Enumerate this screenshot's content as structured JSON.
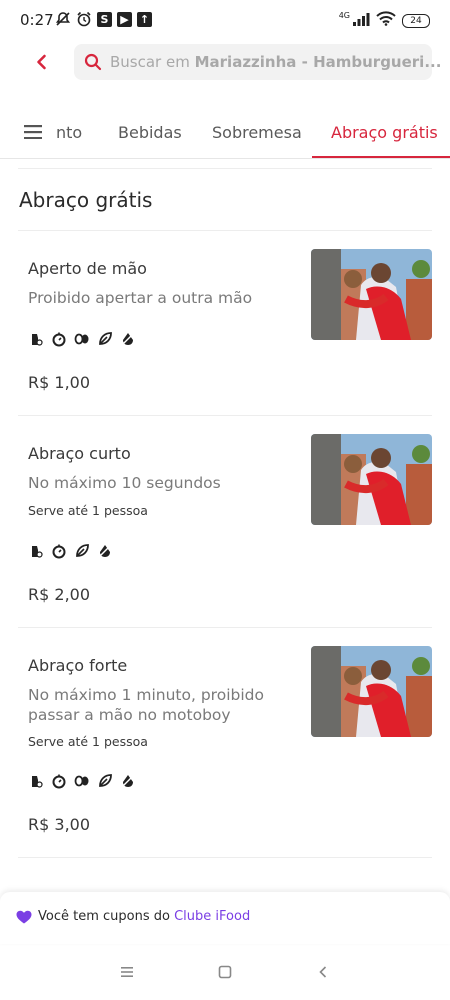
{
  "status": {
    "time": "0:27",
    "network": "4G",
    "battery": "24"
  },
  "search": {
    "placeholder_prefix": "Buscar em ",
    "placeholder_store": "Mariazzinha - Hamburgueri..."
  },
  "tabs": [
    {
      "label": "nto"
    },
    {
      "label": "Bebidas"
    },
    {
      "label": "Sobremesa"
    },
    {
      "label": "Abraço grátis",
      "active": true
    }
  ],
  "section": {
    "title": "Abraço grátis"
  },
  "items": [
    {
      "name": "Aperto de mão",
      "description": "Proibido apertar a outra mão",
      "serves": "",
      "price": "R$ 1,00",
      "tags": [
        "vegetarian-icon",
        "vegan-icon",
        "organic-icon",
        "leaf-icon",
        "sugar-free-icon"
      ]
    },
    {
      "name": "Abraço curto",
      "description": "No máximo 10 segundos",
      "serves": "Serve até 1 pessoa",
      "price": "R$ 2,00",
      "tags": [
        "vegetarian-icon",
        "vegan-icon",
        "leaf-icon",
        "sugar-free-icon"
      ]
    },
    {
      "name": "Abraço forte",
      "description": "No máximo 1 minuto, proibido passar a mão no motoboy",
      "serves": "Serve até 1 pessoa",
      "price": "R$ 3,00",
      "tags": [
        "vegetarian-icon",
        "vegan-icon",
        "organic-icon",
        "leaf-icon",
        "sugar-free-icon"
      ]
    }
  ],
  "coupon": {
    "text": "Você tem cupons do ",
    "link": "Clube iFood"
  },
  "colors": {
    "accent": "#d7263d",
    "coupon_link": "#7b3fe4"
  }
}
